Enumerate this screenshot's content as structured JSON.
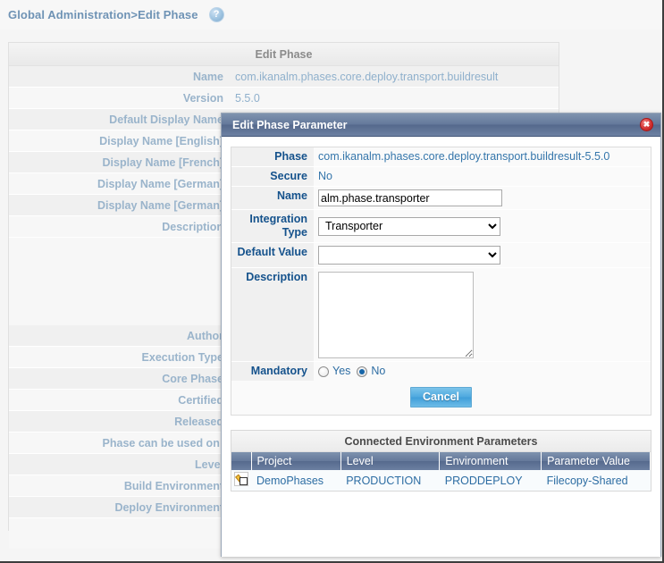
{
  "breadcrumb": {
    "text": "Global Administration>Edit Phase",
    "help_icon": "help-icon",
    "help_glyph": "?"
  },
  "background_panel": {
    "title": "Edit Phase",
    "rows": [
      {
        "label": "Name",
        "value": "com.ikanalm.phases.core.deploy.transport.buildresult"
      },
      {
        "label": "Version",
        "value": "5.5.0"
      },
      {
        "label": "Default Display Name",
        "value": ""
      },
      {
        "label": "Display Name [English]",
        "value": ""
      },
      {
        "label": "Display Name [French]",
        "value": ""
      },
      {
        "label": "Display Name [German]",
        "value": ""
      },
      {
        "label": "Display Name [German]",
        "value": ""
      },
      {
        "label": "Description",
        "value": ""
      }
    ],
    "rows_lower": [
      {
        "label": "Author",
        "value": ""
      },
      {
        "label": "Execution Type",
        "value": ""
      },
      {
        "label": "Core Phase",
        "value": ""
      },
      {
        "label": "Certified",
        "value": ""
      },
      {
        "label": "Released",
        "value": ""
      },
      {
        "label": "Phase can be used on:",
        "value": ""
      },
      {
        "label": "Level",
        "value": ""
      },
      {
        "label": "Build Environment",
        "value": ""
      },
      {
        "label": "Deploy Environment",
        "value": ""
      }
    ]
  },
  "dialog": {
    "title": "Edit Phase Parameter",
    "close_glyph": "✖",
    "fields": {
      "phase_label": "Phase",
      "phase_value": "com.ikanalm.phases.core.deploy.transport.buildresult-5.5.0",
      "secure_label": "Secure",
      "secure_value": "No",
      "name_label": "Name",
      "name_value": "alm.phase.transporter",
      "name_placeholder": "",
      "integration_type_label": "Integration Type",
      "integration_type_value": "Transporter",
      "integration_type_options": [
        "Transporter"
      ],
      "default_value_label": "Default Value",
      "default_value_value": "",
      "default_value_options": [
        ""
      ],
      "description_label": "Description",
      "description_value": "",
      "description_placeholder": "",
      "mandatory_label": "Mandatory",
      "mandatory_yes": "Yes",
      "mandatory_no": "No",
      "mandatory_selected": "No"
    },
    "buttons": {
      "cancel": "Cancel"
    },
    "connected_table": {
      "title": "Connected Environment Parameters",
      "columns": [
        "",
        "Project",
        "Level",
        "Environment",
        "Parameter Value"
      ],
      "rows": [
        {
          "icon": "edit-pencil-icon",
          "project": "DemoPhases",
          "level": "PRODUCTION",
          "environment": "PRODDEPLOY",
          "parameter_value": "Filecopy-Shared"
        }
      ]
    }
  },
  "colors": {
    "titlebar": "#63789a",
    "accent_blue": "#15528c",
    "link_blue": "#2d6da3",
    "muted_blue": "#9ab4cb",
    "close_red": "#d22f2f",
    "button_blue": "#4fa9df"
  }
}
